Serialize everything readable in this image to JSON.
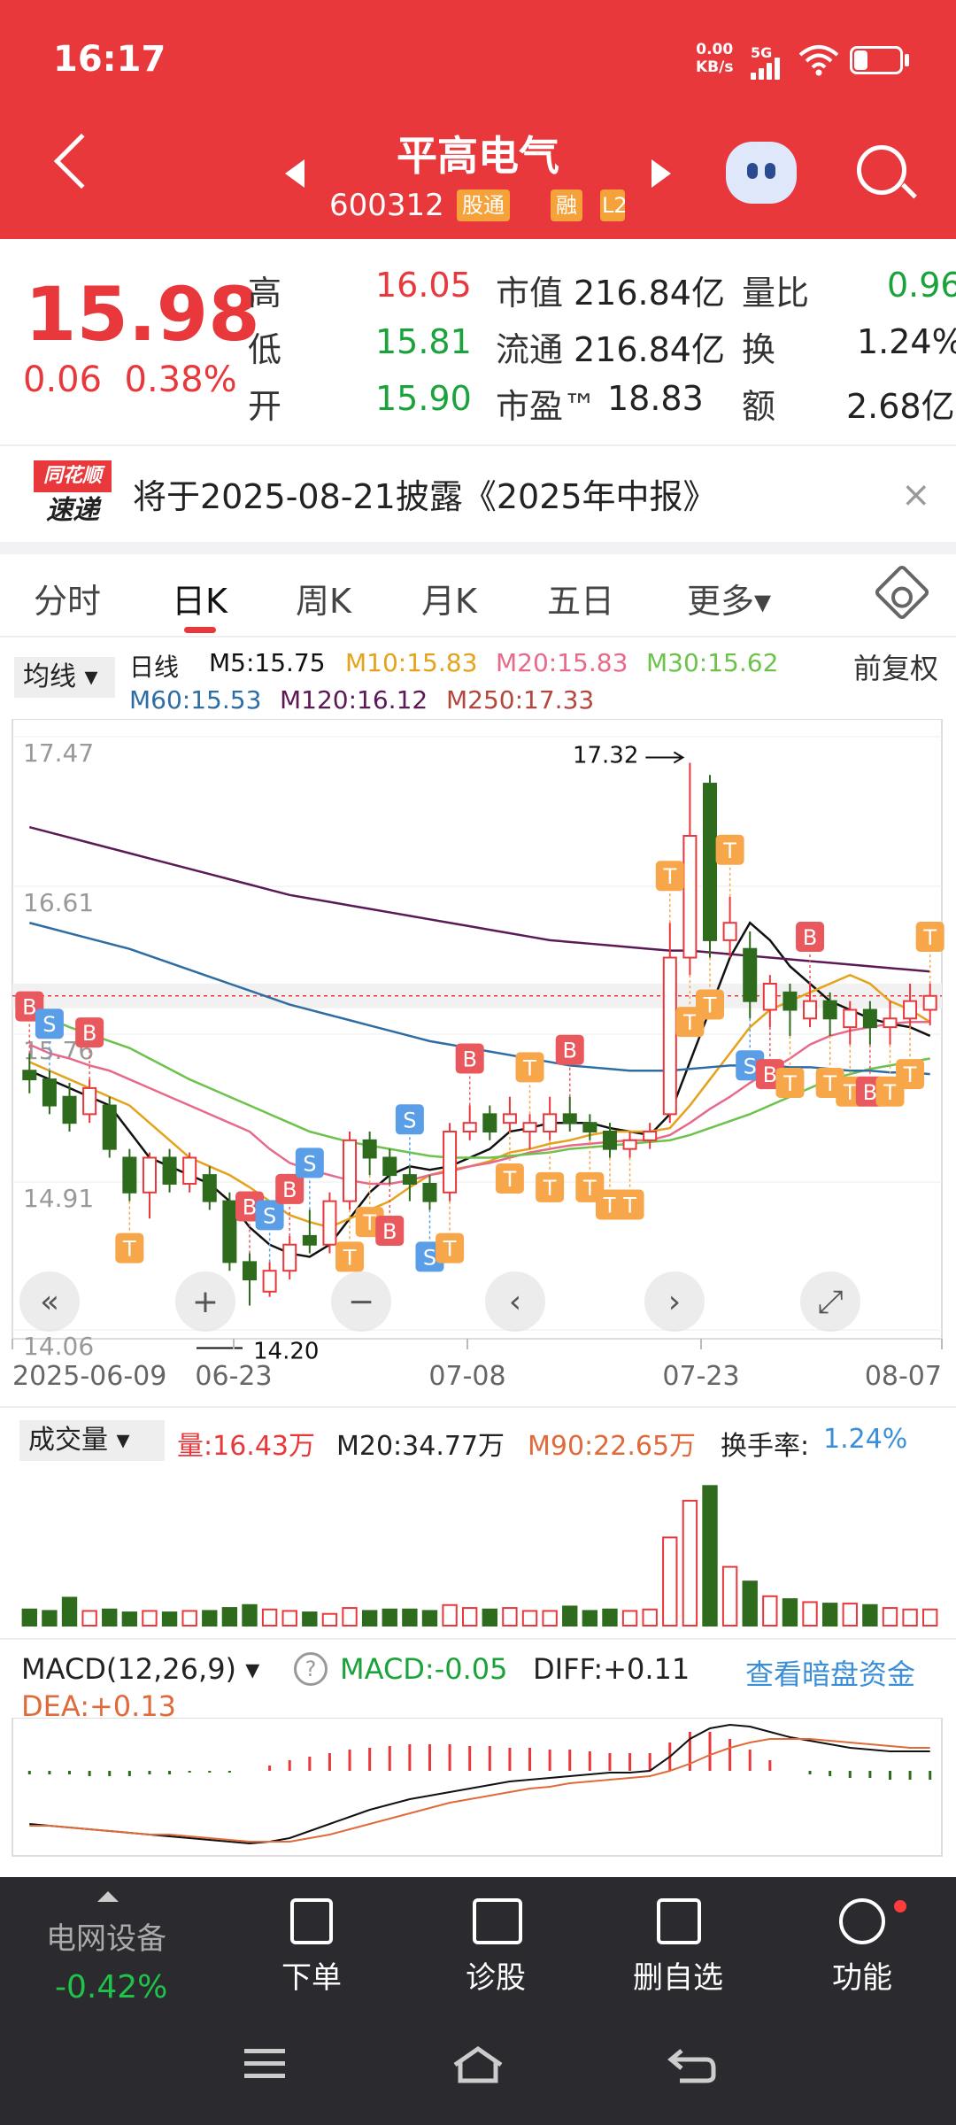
{
  "status": {
    "time": "16:17",
    "net_speed_value": "0.00",
    "net_speed_unit": "KB/s",
    "network": "5G",
    "battery_level": 0.3
  },
  "header": {
    "stock_name": "平高电气",
    "stock_code": "600312",
    "tags": [
      "股通",
      "融",
      "L2"
    ]
  },
  "quote": {
    "price": "15.98",
    "change": "0.06",
    "change_pct": "0.38%",
    "rows": [
      {
        "label": "高",
        "value": "16.05",
        "label2": "市值",
        "value2": "216.84亿",
        "label3": "量比",
        "value3": "0.96"
      },
      {
        "label": "低",
        "value": "15.81",
        "label2": "流通",
        "value2": "216.84亿",
        "label3": "换",
        "value3": "1.24%"
      },
      {
        "label": "开",
        "value": "15.90",
        "label2": "市盈™",
        "value2": "18.83",
        "label3": "额",
        "value3": "2.68亿"
      }
    ]
  },
  "notice": {
    "logo_top": "同花顺",
    "logo_bottom": "速递",
    "text": "将于2025-08-21披露《2025年中报》",
    "close": "×"
  },
  "tabs": [
    "分时",
    "日K",
    "周K",
    "月K",
    "五日",
    "更多▾"
  ],
  "active_tab": 1,
  "ma_legend": {
    "selector": "均线 ▾",
    "period": "日线",
    "items": [
      {
        "text": "M5:15.75",
        "color": "#111111"
      },
      {
        "text": "M10:15.83",
        "color": "#e5a21b"
      },
      {
        "text": "M20:15.83",
        "color": "#e86a8a"
      },
      {
        "text": "M30:15.62",
        "color": "#6cc24a"
      },
      {
        "text": "M60:15.53",
        "color": "#2e6da4"
      },
      {
        "text": "M120:16.12",
        "color": "#5b1a55"
      },
      {
        "text": "M250:17.33",
        "color": "#b2473e"
      }
    ],
    "adjust": "前复权"
  },
  "chart_data": {
    "type": "candlestick",
    "y_ticks": [
      "17.47",
      "16.61",
      "15.76",
      "14.91",
      "14.06"
    ],
    "x_ticks": [
      "2025-06-09",
      "06-23",
      "07-08",
      "07-23",
      "08-07"
    ],
    "ylim": [
      14.06,
      17.47
    ],
    "annotations": {
      "high": "17.32",
      "low": "14.20"
    },
    "candles": [
      {
        "o": 15.55,
        "c": 15.5,
        "h": 15.65,
        "l": 15.42
      },
      {
        "o": 15.5,
        "c": 15.35,
        "h": 15.55,
        "l": 15.3
      },
      {
        "o": 15.4,
        "c": 15.25,
        "h": 15.48,
        "l": 15.2
      },
      {
        "o": 15.3,
        "c": 15.45,
        "h": 15.5,
        "l": 15.25
      },
      {
        "o": 15.35,
        "c": 15.1,
        "h": 15.4,
        "l": 15.05
      },
      {
        "o": 15.05,
        "c": 14.85,
        "h": 15.1,
        "l": 14.8
      },
      {
        "o": 14.85,
        "c": 15.05,
        "h": 15.08,
        "l": 14.7
      },
      {
        "o": 15.05,
        "c": 14.9,
        "h": 15.1,
        "l": 14.85
      },
      {
        "o": 14.9,
        "c": 15.05,
        "h": 15.08,
        "l": 14.85
      },
      {
        "o": 14.95,
        "c": 14.8,
        "h": 15.0,
        "l": 14.75
      },
      {
        "o": 14.8,
        "c": 14.45,
        "h": 14.85,
        "l": 14.4
      },
      {
        "o": 14.45,
        "c": 14.35,
        "h": 14.5,
        "l": 14.2
      },
      {
        "o": 14.28,
        "c": 14.4,
        "h": 14.45,
        "l": 14.25
      },
      {
        "o": 14.4,
        "c": 14.55,
        "h": 14.6,
        "l": 14.35
      },
      {
        "o": 14.6,
        "c": 14.55,
        "h": 14.75,
        "l": 14.5
      },
      {
        "o": 14.55,
        "c": 14.8,
        "h": 14.85,
        "l": 14.5
      },
      {
        "o": 14.8,
        "c": 15.15,
        "h": 15.2,
        "l": 14.75
      },
      {
        "o": 15.15,
        "c": 15.05,
        "h": 15.2,
        "l": 14.95
      },
      {
        "o": 15.05,
        "c": 14.95,
        "h": 15.1,
        "l": 14.9
      },
      {
        "o": 14.95,
        "c": 14.9,
        "h": 15.0,
        "l": 14.8
      },
      {
        "o": 14.9,
        "c": 14.8,
        "h": 14.95,
        "l": 14.75
      },
      {
        "o": 14.85,
        "c": 15.2,
        "h": 15.25,
        "l": 14.8
      },
      {
        "o": 15.2,
        "c": 15.25,
        "h": 15.35,
        "l": 15.15
      },
      {
        "o": 15.3,
        "c": 15.2,
        "h": 15.35,
        "l": 15.15
      },
      {
        "o": 15.25,
        "c": 15.3,
        "h": 15.4,
        "l": 15.2
      },
      {
        "o": 15.2,
        "c": 15.25,
        "h": 15.3,
        "l": 15.1
      },
      {
        "o": 15.2,
        "c": 15.3,
        "h": 15.4,
        "l": 15.15
      },
      {
        "o": 15.3,
        "c": 15.25,
        "h": 15.4,
        "l": 15.2
      },
      {
        "o": 15.25,
        "c": 15.2,
        "h": 15.3,
        "l": 15.15
      },
      {
        "o": 15.2,
        "c": 15.1,
        "h": 15.25,
        "l": 15.05
      },
      {
        "o": 15.1,
        "c": 15.15,
        "h": 15.2,
        "l": 15.05
      },
      {
        "o": 15.15,
        "c": 15.2,
        "h": 15.25,
        "l": 15.1
      },
      {
        "o": 15.3,
        "c": 16.2,
        "h": 16.4,
        "l": 15.25
      },
      {
        "o": 16.2,
        "c": 16.9,
        "h": 17.32,
        "l": 16.1
      },
      {
        "o": 17.2,
        "c": 16.3,
        "h": 17.25,
        "l": 16.2
      },
      {
        "o": 16.3,
        "c": 16.4,
        "h": 16.55,
        "l": 16.2
      },
      {
        "o": 16.25,
        "c": 15.95,
        "h": 16.35,
        "l": 15.85
      },
      {
        "o": 15.9,
        "c": 16.05,
        "h": 16.1,
        "l": 15.8
      },
      {
        "o": 16.0,
        "c": 15.9,
        "h": 16.05,
        "l": 15.75
      },
      {
        "o": 15.85,
        "c": 15.95,
        "h": 16.05,
        "l": 15.8
      },
      {
        "o": 15.95,
        "c": 15.85,
        "h": 16.0,
        "l": 15.75
      },
      {
        "o": 15.8,
        "c": 15.9,
        "h": 15.95,
        "l": 15.7
      },
      {
        "o": 15.9,
        "c": 15.8,
        "h": 15.95,
        "l": 15.7
      },
      {
        "o": 15.8,
        "c": 15.85,
        "h": 15.95,
        "l": 15.7
      },
      {
        "o": 15.85,
        "c": 15.95,
        "h": 16.05,
        "l": 15.8
      },
      {
        "o": 15.9,
        "c": 15.98,
        "h": 16.05,
        "l": 15.81
      }
    ],
    "ma": {
      "M5": [
        15.55,
        15.5,
        15.45,
        15.4,
        15.35,
        15.2,
        15.05,
        15.0,
        14.95,
        14.9,
        14.8,
        14.65,
        14.55,
        14.5,
        14.48,
        14.55,
        14.7,
        14.85,
        14.95,
        15.0,
        14.98,
        15.0,
        15.05,
        15.1,
        15.2,
        15.22,
        15.25,
        15.25,
        15.25,
        15.22,
        15.2,
        15.18,
        15.3,
        15.6,
        15.9,
        16.2,
        16.4,
        16.3,
        16.15,
        16.05,
        15.95,
        15.9,
        15.85,
        15.82,
        15.8,
        15.75
      ],
      "M10": [
        15.6,
        15.55,
        15.5,
        15.45,
        15.4,
        15.35,
        15.25,
        15.15,
        15.05,
        15.0,
        14.95,
        14.88,
        14.8,
        14.72,
        14.68,
        14.65,
        14.7,
        14.75,
        14.8,
        14.88,
        14.95,
        14.98,
        15.0,
        15.03,
        15.08,
        15.1,
        15.13,
        15.15,
        15.18,
        15.2,
        15.2,
        15.2,
        15.22,
        15.35,
        15.5,
        15.65,
        15.8,
        15.9,
        15.95,
        16.0,
        16.05,
        16.1,
        16.05,
        15.95,
        15.9,
        15.83
      ],
      "M20": [
        15.7,
        15.65,
        15.62,
        15.58,
        15.55,
        15.5,
        15.45,
        15.4,
        15.35,
        15.3,
        15.25,
        15.2,
        15.1,
        15.02,
        14.98,
        14.95,
        14.92,
        14.9,
        14.9,
        14.92,
        14.95,
        14.97,
        15.0,
        15.02,
        15.05,
        15.08,
        15.1,
        15.12,
        15.13,
        15.14,
        15.15,
        15.15,
        15.18,
        15.25,
        15.33,
        15.4,
        15.48,
        15.55,
        15.62,
        15.7,
        15.75,
        15.78,
        15.8,
        15.82,
        15.83,
        15.83
      ],
      "M30": [
        15.9,
        15.85,
        15.8,
        15.76,
        15.72,
        15.68,
        15.62,
        15.56,
        15.5,
        15.45,
        15.4,
        15.35,
        15.3,
        15.25,
        15.2,
        15.17,
        15.14,
        15.12,
        15.1,
        15.08,
        15.06,
        15.05,
        15.05,
        15.05,
        15.06,
        15.07,
        15.08,
        15.1,
        15.11,
        15.12,
        15.13,
        15.14,
        15.15,
        15.18,
        15.22,
        15.26,
        15.3,
        15.35,
        15.4,
        15.45,
        15.5,
        15.53,
        15.56,
        15.58,
        15.6,
        15.62
      ],
      "M60": [
        16.4,
        16.37,
        16.34,
        16.31,
        16.28,
        16.25,
        16.21,
        16.17,
        16.13,
        16.09,
        16.05,
        16.01,
        15.97,
        15.93,
        15.9,
        15.87,
        15.84,
        15.81,
        15.78,
        15.75,
        15.72,
        15.7,
        15.68,
        15.66,
        15.64,
        15.62,
        15.6,
        15.58,
        15.57,
        15.56,
        15.55,
        15.55,
        15.55,
        15.56,
        15.57,
        15.58,
        15.58,
        15.58,
        15.57,
        15.57,
        15.56,
        15.55,
        15.55,
        15.54,
        15.54,
        15.53
      ],
      "M120": [
        16.95,
        16.92,
        16.89,
        16.86,
        16.83,
        16.8,
        16.77,
        16.74,
        16.71,
        16.68,
        16.65,
        16.62,
        16.59,
        16.56,
        16.54,
        16.52,
        16.5,
        16.48,
        16.46,
        16.44,
        16.42,
        16.4,
        16.38,
        16.36,
        16.34,
        16.32,
        16.3,
        16.29,
        16.28,
        16.27,
        16.26,
        16.25,
        16.24,
        16.24,
        16.23,
        16.22,
        16.21,
        16.2,
        16.19,
        16.18,
        16.17,
        16.16,
        16.15,
        16.14,
        16.13,
        16.12
      ]
    },
    "signals": [
      {
        "i": 0,
        "t": "B",
        "pos": "above"
      },
      {
        "i": 1,
        "t": "S",
        "pos": "above"
      },
      {
        "i": 3,
        "t": "B",
        "pos": "above"
      },
      {
        "i": 5,
        "t": "T",
        "pos": "below"
      },
      {
        "i": 11,
        "t": "B",
        "pos": "above"
      },
      {
        "i": 12,
        "t": "S",
        "pos": "above"
      },
      {
        "i": 13,
        "t": "B",
        "pos": "above"
      },
      {
        "i": 14,
        "t": "S",
        "pos": "above"
      },
      {
        "i": 16,
        "t": "T",
        "pos": "below"
      },
      {
        "i": 17,
        "t": "T",
        "pos": "below"
      },
      {
        "i": 18,
        "t": "B",
        "pos": "below"
      },
      {
        "i": 19,
        "t": "S",
        "pos": "above"
      },
      {
        "i": 20,
        "t": "S",
        "pos": "below"
      },
      {
        "i": 21,
        "t": "T",
        "pos": "below"
      },
      {
        "i": 22,
        "t": "B",
        "pos": "above"
      },
      {
        "i": 24,
        "t": "T",
        "pos": "below"
      },
      {
        "i": 25,
        "t": "T",
        "pos": "above"
      },
      {
        "i": 26,
        "t": "T",
        "pos": "below"
      },
      {
        "i": 27,
        "t": "B",
        "pos": "above"
      },
      {
        "i": 28,
        "t": "T",
        "pos": "below"
      },
      {
        "i": 29,
        "t": "T",
        "pos": "below"
      },
      {
        "i": 30,
        "t": "T",
        "pos": "below"
      },
      {
        "i": 32,
        "t": "T",
        "pos": "above"
      },
      {
        "i": 33,
        "t": "T",
        "pos": "below"
      },
      {
        "i": 34,
        "t": "T",
        "pos": "below"
      },
      {
        "i": 35,
        "t": "T",
        "pos": "above"
      },
      {
        "i": 36,
        "t": "S",
        "pos": "below"
      },
      {
        "i": 37,
        "t": "B",
        "pos": "below"
      },
      {
        "i": 38,
        "t": "T",
        "pos": "below"
      },
      {
        "i": 39,
        "t": "B",
        "pos": "above"
      },
      {
        "i": 40,
        "t": "T",
        "pos": "below"
      },
      {
        "i": 41,
        "t": "T",
        "pos": "below"
      },
      {
        "i": 42,
        "t": "B",
        "pos": "below"
      },
      {
        "i": 43,
        "t": "T",
        "pos": "below"
      },
      {
        "i": 44,
        "t": "T",
        "pos": "below"
      },
      {
        "i": 45,
        "t": "T",
        "pos": "above"
      }
    ],
    "nav_buttons": [
      "«",
      "+",
      "−",
      "‹",
      "›",
      "⤢"
    ]
  },
  "volume": {
    "selector": "成交量 ▾",
    "label_vol": "量:16.43万",
    "label_m20": "M20:34.77万",
    "label_m90": "M90:22.65万",
    "label_turn_name": "换手率:",
    "label_turn": "1.24%",
    "values": [
      22,
      20,
      38,
      20,
      22,
      18,
      20,
      18,
      20,
      20,
      24,
      28,
      22,
      20,
      18,
      16,
      24,
      20,
      22,
      22,
      20,
      28,
      24,
      22,
      24,
      20,
      20,
      26,
      20,
      22,
      20,
      22,
      120,
      170,
      190,
      80,
      60,
      40,
      36,
      32,
      30,
      30,
      28,
      24,
      22,
      22
    ],
    "ylim": [
      0,
      200
    ]
  },
  "macd": {
    "selector": "MACD(12,26,9) ▾",
    "help": "?",
    "label_macd": "MACD:-0.05",
    "label_diff": "DIFF:+0.11",
    "label_dea": "DEA:+0.13",
    "link": "查看暗盘资金",
    "hist": [
      -0.02,
      -0.02,
      -0.02,
      -0.03,
      -0.03,
      -0.03,
      -0.02,
      -0.02,
      -0.01,
      -0.01,
      -0.01,
      0.0,
      0.03,
      0.06,
      0.08,
      0.1,
      0.12,
      0.13,
      0.14,
      0.15,
      0.15,
      0.15,
      0.14,
      0.14,
      0.13,
      0.13,
      0.12,
      0.12,
      0.11,
      0.1,
      0.1,
      0.1,
      0.16,
      0.22,
      0.22,
      0.18,
      0.12,
      0.06,
      0.0,
      -0.02,
      -0.03,
      -0.04,
      -0.04,
      -0.05,
      -0.05,
      -0.05
    ],
    "diff": [
      -0.3,
      -0.31,
      -0.32,
      -0.33,
      -0.34,
      -0.35,
      -0.36,
      -0.37,
      -0.38,
      -0.39,
      -0.4,
      -0.41,
      -0.4,
      -0.38,
      -0.34,
      -0.3,
      -0.26,
      -0.22,
      -0.19,
      -0.16,
      -0.14,
      -0.12,
      -0.1,
      -0.08,
      -0.06,
      -0.05,
      -0.04,
      -0.03,
      -0.02,
      -0.01,
      -0.01,
      0.0,
      0.08,
      0.18,
      0.24,
      0.26,
      0.25,
      0.22,
      0.19,
      0.17,
      0.15,
      0.13,
      0.12,
      0.11,
      0.11,
      0.11
    ],
    "dea": [
      -0.31,
      -0.31,
      -0.32,
      -0.33,
      -0.34,
      -0.35,
      -0.36,
      -0.36,
      -0.37,
      -0.38,
      -0.39,
      -0.4,
      -0.4,
      -0.4,
      -0.38,
      -0.36,
      -0.33,
      -0.3,
      -0.27,
      -0.24,
      -0.21,
      -0.18,
      -0.16,
      -0.14,
      -0.12,
      -0.1,
      -0.09,
      -0.07,
      -0.06,
      -0.05,
      -0.04,
      -0.03,
      0.0,
      0.04,
      0.09,
      0.13,
      0.16,
      0.18,
      0.18,
      0.18,
      0.17,
      0.16,
      0.15,
      0.14,
      0.13,
      0.13
    ],
    "ylim": [
      -0.45,
      0.3
    ]
  },
  "bottom": {
    "sector_name": "电网设备",
    "sector_pct": "-0.42%",
    "nav": [
      {
        "label": "下单"
      },
      {
        "label": "诊股"
      },
      {
        "label": "删自选"
      },
      {
        "label": "功能"
      }
    ]
  },
  "colors": {
    "up": "#e8383c",
    "down": "#2e6b1d",
    "accent": "#e8383c",
    "signal_T": "#f7a74a",
    "signal_B": "#e8585c",
    "signal_S": "#5b9ee8"
  }
}
